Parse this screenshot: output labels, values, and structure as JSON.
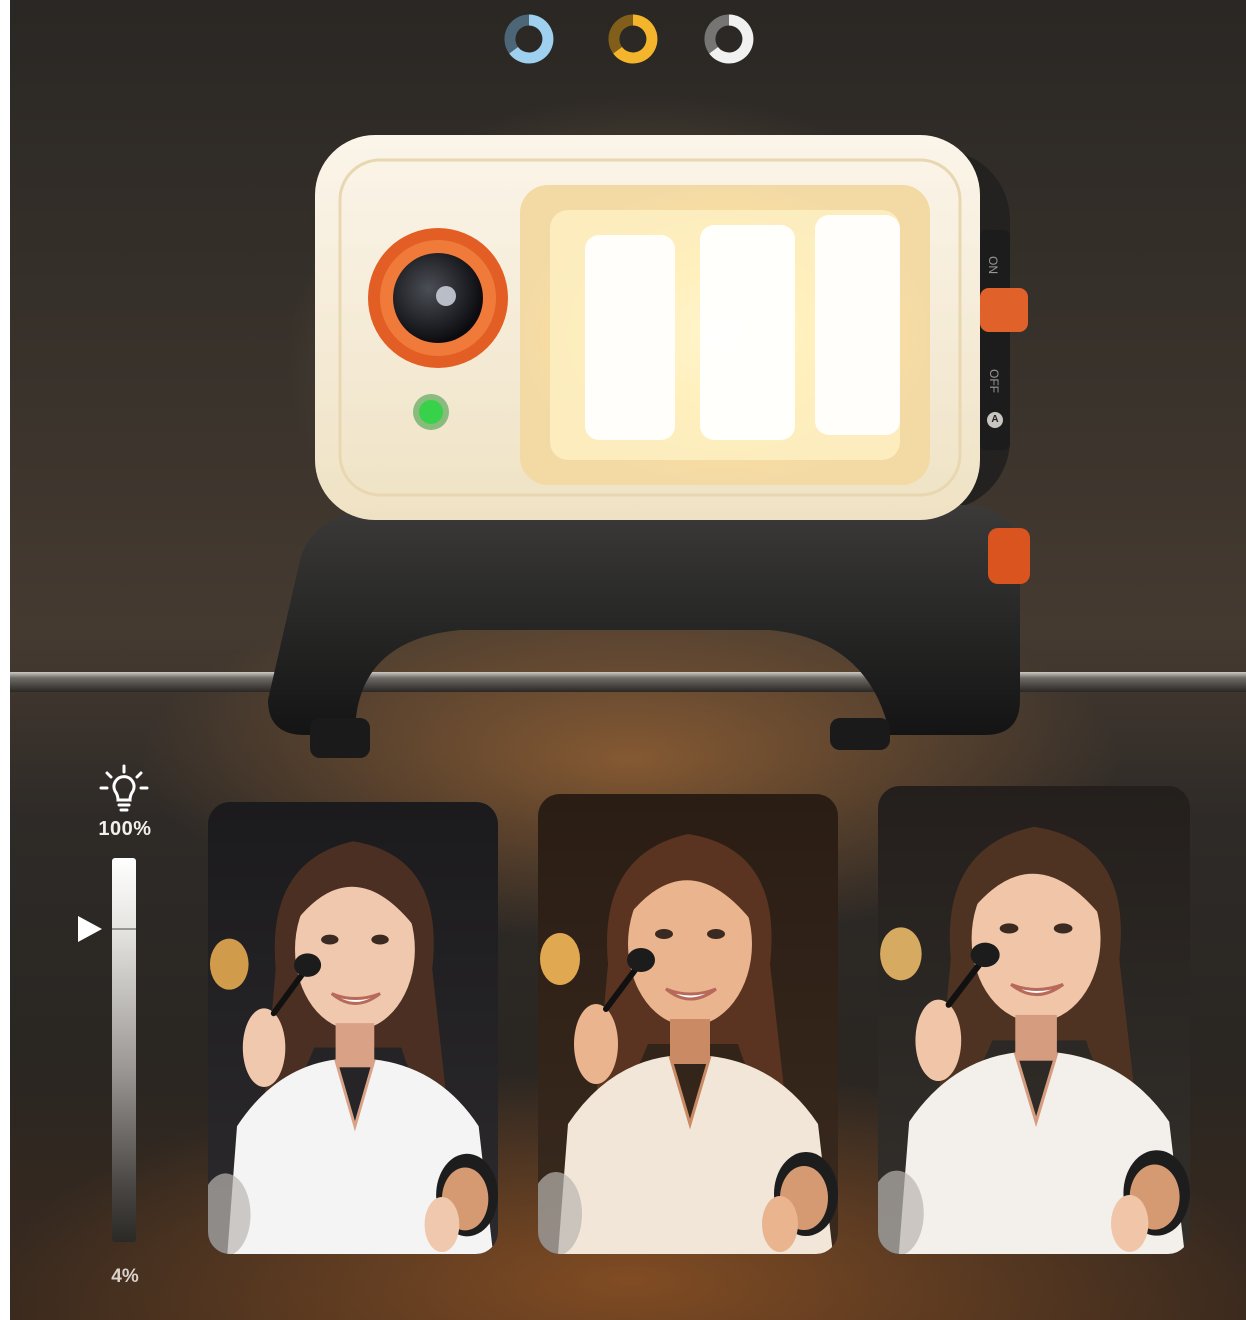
{
  "color_temperature_options": [
    {
      "icon": "cool-ring-icon",
      "color": "#9fd0ef"
    },
    {
      "icon": "warm-ring-icon",
      "color": "#f4b52c"
    },
    {
      "icon": "neutral-ring-icon",
      "color": "#f1f1f1"
    }
  ],
  "device": {
    "switch_on_label": "ON",
    "switch_off_label": "OFF",
    "switch_auto_label": "A",
    "accent_color": "#e0622a",
    "indicator_color": "#38d14a"
  },
  "brightness": {
    "max_label": "100%",
    "min_label": "4%",
    "level_percent": 100
  },
  "portraits": [
    {
      "tone": "cool"
    },
    {
      "tone": "warm"
    },
    {
      "tone": "neutral"
    }
  ]
}
